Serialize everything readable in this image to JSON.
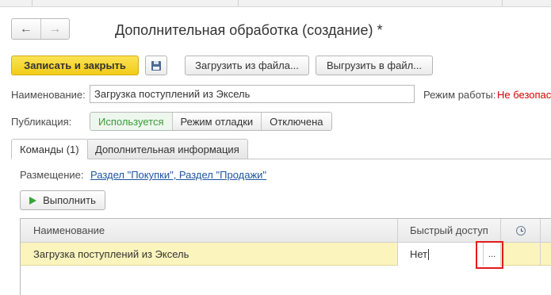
{
  "window": {
    "title": "Дополнительная обработка (создание) *"
  },
  "nav": {
    "back_icon": "arrow-left-icon",
    "forward_icon": "arrow-right-icon",
    "back_glyph": "←",
    "forward_glyph": "→"
  },
  "toolbar": {
    "save_close_label": "Записать и закрыть",
    "save_icon": "floppy-disk-icon",
    "load_label": "Загрузить из файла...",
    "unload_label": "Выгрузить в файл..."
  },
  "form": {
    "name_label": "Наименование:",
    "name_value": "Загрузка поступлений из Эксель",
    "mode_label": "Режим работы:",
    "mode_value": "Не безопас",
    "publication_label": "Публикация:",
    "publication_options": [
      "Используется",
      "Режим отладки",
      "Отключена"
    ],
    "publication_selected": "Используется"
  },
  "tabs": [
    {
      "label": "Команды (1)",
      "active": true
    },
    {
      "label": "Дополнительная информация",
      "active": false
    }
  ],
  "commands": {
    "placement_label": "Размещение:",
    "placement_link": "Раздел \"Покупки\", Раздел \"Продажи\"",
    "execute_label": "Выполнить",
    "table": {
      "headers": {
        "name": "Наименование",
        "quick_access": "Быстрый доступ",
        "schedule_icon": "clock-icon"
      },
      "rows": [
        {
          "name": "Загрузка поступлений из Эксель",
          "quick_access": "Нет",
          "select_button": "..."
        }
      ]
    }
  },
  "colors": {
    "primary_button": "#f2cc17",
    "active_option": "#3a9a3a",
    "warning_text": "#d40000",
    "selected_row": "#fbf4bd",
    "link": "#1e56a0",
    "highlight_box": "#e21b1b"
  }
}
